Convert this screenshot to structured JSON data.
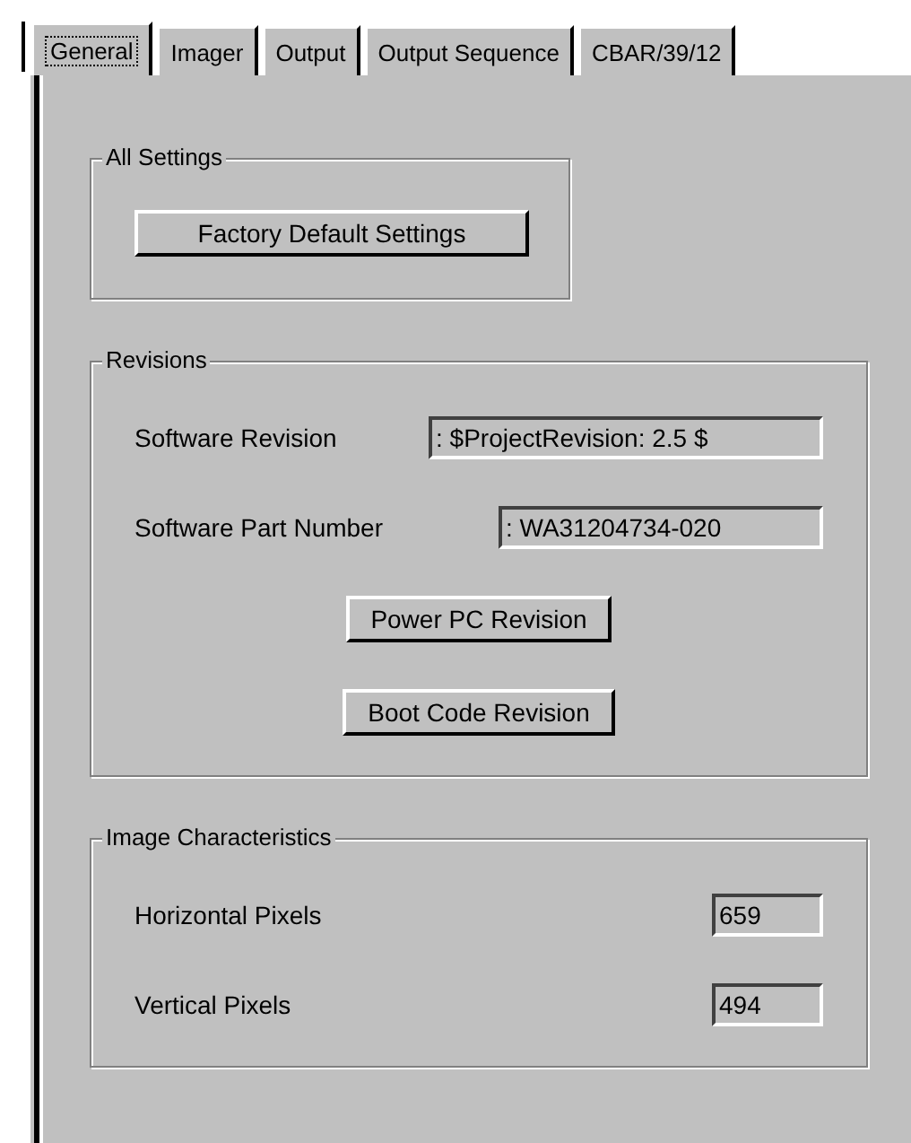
{
  "tabs": [
    {
      "label": "General",
      "selected": true
    },
    {
      "label": "Imager",
      "selected": false
    },
    {
      "label": "Output",
      "selected": false
    },
    {
      "label": "Output Sequence",
      "selected": false
    },
    {
      "label": "CBAR/39/12",
      "selected": false
    }
  ],
  "groups": [
    {
      "title": "All Settings",
      "items": [
        {
          "kind": "button",
          "label": "Factory Default Settings"
        }
      ]
    },
    {
      "title": "Revisions",
      "items": [
        {
          "kind": "field",
          "label": "Software Revision",
          "value": ": $ProjectRevision: 2.5 $"
        },
        {
          "kind": "field",
          "label": "Software Part Number",
          "value": ": WA31204734-020"
        },
        {
          "kind": "button",
          "label": "Power PC Revision"
        },
        {
          "kind": "button",
          "label": "Boot Code Revision"
        }
      ]
    },
    {
      "title": "Image Characteristics",
      "items": [
        {
          "kind": "field",
          "label": "Horizontal Pixels",
          "value": "659"
        },
        {
          "kind": "field",
          "label": "Vertical Pixels",
          "value": "494"
        }
      ]
    }
  ]
}
